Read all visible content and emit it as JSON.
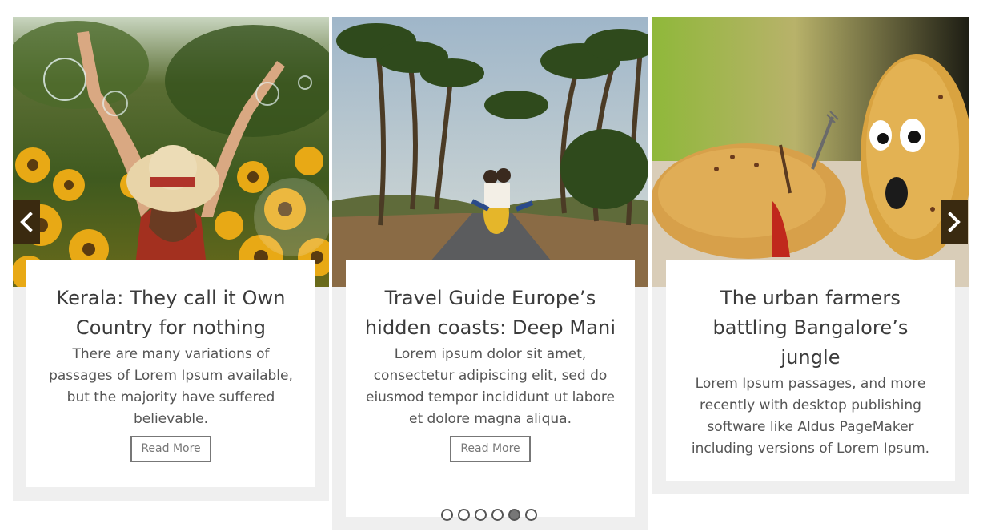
{
  "carousel": {
    "cards": [
      {
        "title": "Kerala: They call it Own Country for nothing",
        "text": "There are many variations of passages of Lorem Ipsum available, but the majority have suffered believable.",
        "button": "Read More",
        "image_icon": "woman-sunflowers-bubbles-photo"
      },
      {
        "title": "Travel Guide Europe’s hidden coasts: Deep Mani",
        "text": "Lorem ipsum dolor sit amet, consectetur adipiscing elit, sed do eiusmod tempor incididunt ut labore et dolore magna aliqua.",
        "button": "Read More",
        "image_icon": "palm-road-scooter-photo"
      },
      {
        "title": "The urban farmers battling Bangalore’s jungle",
        "text": "Lorem Ipsum passages, and more recently with desktop publishing software like Aldus PageMaker including versions of Lorem Ipsum.",
        "image_icon": "potatoes-fork-photo"
      }
    ],
    "prev_icon": "chevron-left-icon",
    "next_icon": "chevron-right-icon",
    "dots": {
      "count": 6,
      "active_index": 4
    },
    "colors": {
      "arrow_bg": "#3a2a10",
      "card_bg": "#efefef",
      "dot_active": "#777777"
    }
  }
}
